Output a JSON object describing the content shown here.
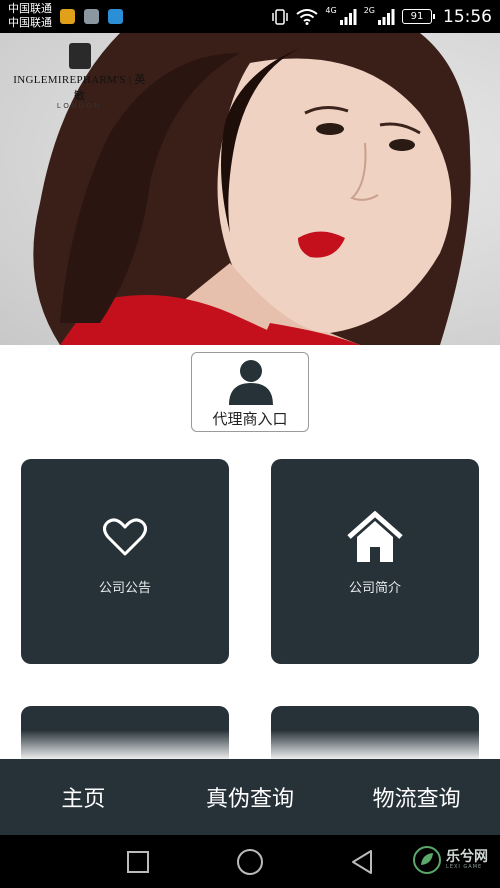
{
  "status_bar": {
    "carrier1": "中国联通",
    "carrier2": "中国联通",
    "sig1": "4G",
    "sig2": "2G",
    "battery": "91",
    "time": "15:56"
  },
  "hero": {
    "brand_name": "INGLEMIREPHARM'S | 英敏",
    "brand_sub": "LONDON"
  },
  "agent_entry": {
    "label": "代理商入口"
  },
  "tiles": [
    {
      "label": "公司公告",
      "icon": "heart-icon"
    },
    {
      "label": "公司简介",
      "icon": "home-icon"
    }
  ],
  "tabs": [
    {
      "label": "主页"
    },
    {
      "label": "真伪查询"
    },
    {
      "label": "物流查询"
    }
  ],
  "watermark": {
    "text": "乐兮网",
    "sub": "LEXI GAME"
  },
  "colors": {
    "tile_bg": "#263238",
    "tabbar_bg": "#263238",
    "lipstick": "#c4101c"
  }
}
